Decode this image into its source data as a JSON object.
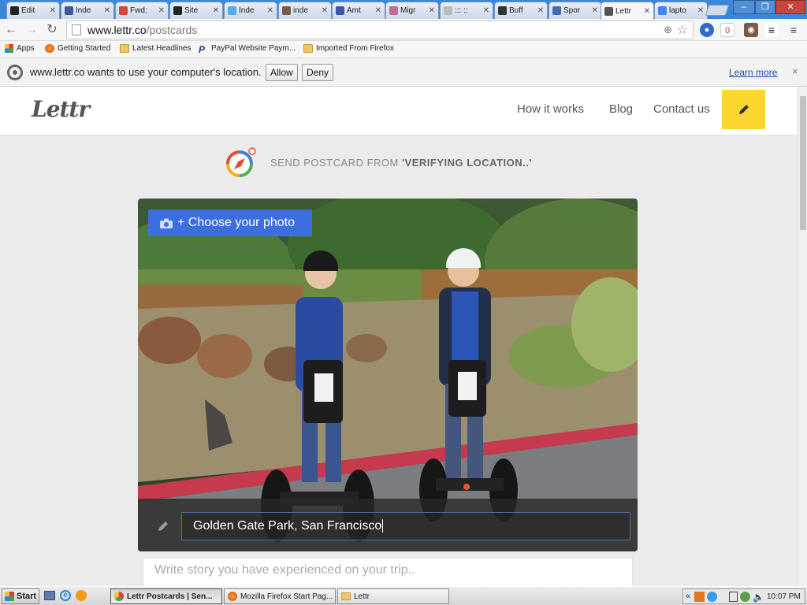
{
  "tabs": [
    {
      "label": "Edit",
      "favicon": "paw-icon",
      "color": "#222222"
    },
    {
      "label": "Inde",
      "favicon": "facebook-icon",
      "color": "#3b5998"
    },
    {
      "label": "Fwd:",
      "favicon": "gmail-icon",
      "color": "#d44638"
    },
    {
      "label": "Site",
      "favicon": "paw-icon",
      "color": "#222222"
    },
    {
      "label": "Inde",
      "favicon": "twitter-icon",
      "color": "#55acee"
    },
    {
      "label": "inde",
      "favicon": "instagram-icon",
      "color": "#7a5a46"
    },
    {
      "label": "Amt",
      "favicon": "globe-icon",
      "color": "#3a5aa8"
    },
    {
      "label": "Migr",
      "favicon": "ribbon-icon",
      "color": "#c06aa0"
    },
    {
      "label": "::: ::",
      "favicon": "page-icon",
      "color": "#bbbbbb"
    },
    {
      "label": "Buff",
      "favicon": "buffer-icon",
      "color": "#333333"
    },
    {
      "label": "Spor",
      "favicon": "sport-icon",
      "color": "#3f6fb0"
    },
    {
      "label": "Lettr",
      "favicon": "lettr-icon",
      "color": "#555555",
      "active": true
    },
    {
      "label": "lapto",
      "favicon": "google-icon",
      "color": "#4285f4"
    }
  ],
  "toolbar": {
    "url_host": "www.lettr.co",
    "url_path": "/postcards"
  },
  "bookmarks": [
    {
      "label": "Apps",
      "icon": "apps-grid-icon"
    },
    {
      "label": "Getting Started",
      "icon": "firefox-icon"
    },
    {
      "label": "Latest Headlines",
      "icon": "folder-icon"
    },
    {
      "label": "PayPal Website Paym...",
      "icon": "paypal-icon"
    },
    {
      "label": "Imported From Firefox",
      "icon": "folder-icon"
    }
  ],
  "infobar": {
    "message": "www.lettr.co wants to use your computer's location.",
    "allow": "Allow",
    "deny": "Deny",
    "learn_more": "Learn more",
    "close": "×"
  },
  "site": {
    "logo": "Lettr",
    "nav": [
      "How it works",
      "Blog",
      "Contact us"
    ],
    "accent": "#fbd530",
    "send_prefix": "SEND POSTCARD FROM ",
    "send_location": "'VERIFYING LOCATION..'",
    "choose_photo": "+ Choose your photo",
    "location_value": "Golden Gate Park, San Francisco",
    "story_placeholder": "Write story you have experienced on your trip.."
  },
  "taskbar": {
    "start": "Start",
    "items": [
      {
        "label": "Lettr Postcards | Sen...",
        "active": true
      },
      {
        "label": "Mozilla Firefox Start Pag..."
      },
      {
        "label": "Lettr"
      }
    ],
    "clock": "10:07 PM"
  }
}
